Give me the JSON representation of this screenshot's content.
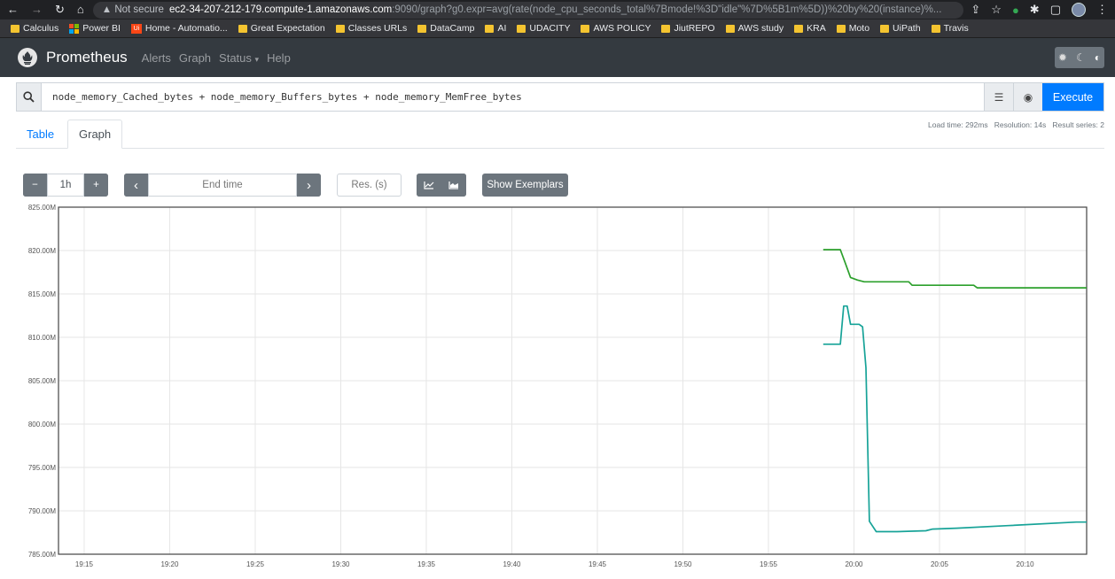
{
  "browser": {
    "nav_icons": [
      "back-arrow-icon",
      "forward-arrow-icon",
      "reload-icon",
      "home-icon"
    ],
    "security_label": "▲ Not secure",
    "url_host": "ec2-34-207-212-179.compute-1.amazonaws.com",
    "url_rest": ":9090/graph?g0.expr=avg(rate(node_cpu_seconds_total%7Bmode!%3D\"idle\"%7D%5B1m%5D))%20by%20(instance)%...",
    "bookmarks": [
      "Calculus",
      "Power BI",
      "Home - Automatio...",
      "Great Expectation",
      "Classes URLs",
      "DataCamp",
      "AI",
      "UDACITY",
      "AWS POLICY",
      "JiutREPO",
      "AWS study",
      "KRA",
      "Moto",
      "UiPath",
      "Travis"
    ]
  },
  "app": {
    "brand": "Prometheus",
    "nav": [
      "Alerts",
      "Graph",
      "Status",
      "Help"
    ]
  },
  "query": {
    "expression": "node_memory_Cached_bytes + node_memory_Buffers_bytes + node_memory_MemFree_bytes",
    "execute_label": "Execute"
  },
  "tabs": {
    "table": "Table",
    "graph": "Graph"
  },
  "meta": {
    "load_time": "Load time: 292ms",
    "resolution": "Resolution: 14s",
    "result_series": "Result series: 2"
  },
  "controls": {
    "minus": "−",
    "range": "1h",
    "plus": "+",
    "prev": "‹",
    "end_time_placeholder": "End time",
    "next": "›",
    "res_placeholder": "Res. (s)",
    "exemplars": "Show Exemplars"
  },
  "chart_data": {
    "type": "line",
    "ylim": [
      785000000,
      825000000
    ],
    "y_ticks": [
      "825.00M",
      "820.00M",
      "815.00M",
      "810.00M",
      "805.00M",
      "800.00M",
      "795.00M",
      "790.00M",
      "785.00M"
    ],
    "x_ticks": [
      "19:15",
      "19:20",
      "19:25",
      "19:30",
      "19:35",
      "19:40",
      "19:45",
      "19:50",
      "19:55",
      "20:00",
      "20:05",
      "20:10"
    ],
    "x_range_minutes": [
      "19:13.5",
      "20:13.6"
    ],
    "series": [
      {
        "color": "#2ca02c",
        "points": [
          [
            "19:58.2",
            820.1
          ],
          [
            "19:59.2",
            820.1
          ],
          [
            "19:59.5",
            818.5
          ],
          [
            "19:59.8",
            816.9
          ],
          [
            "20:00.2",
            816.6
          ],
          [
            "20:00.6",
            816.4
          ],
          [
            "20:03.2",
            816.4
          ],
          [
            "20:03.4",
            816.0
          ],
          [
            "20:07.0",
            816.0
          ],
          [
            "20:07.2",
            815.7
          ],
          [
            "20:13.6",
            815.7
          ]
        ]
      },
      {
        "color": "#17a398",
        "points": [
          [
            "19:58.2",
            809.2
          ],
          [
            "19:59.2",
            809.2
          ],
          [
            "19:59.4",
            813.6
          ],
          [
            "19:59.6",
            813.6
          ],
          [
            "19:59.8",
            811.5
          ],
          [
            "20:00.3",
            811.5
          ],
          [
            "20:00.5",
            811.2
          ],
          [
            "20:00.7",
            806.5
          ],
          [
            "20:00.9",
            788.8
          ],
          [
            "20:01.3",
            787.6
          ],
          [
            "20:02.5",
            787.6
          ],
          [
            "20:04.2",
            787.7
          ],
          [
            "20:04.6",
            787.9
          ],
          [
            "20:06.0",
            788.0
          ],
          [
            "20:09.0",
            788.3
          ],
          [
            "20:13.0",
            788.7
          ],
          [
            "20:13.6",
            788.7
          ]
        ]
      }
    ]
  }
}
